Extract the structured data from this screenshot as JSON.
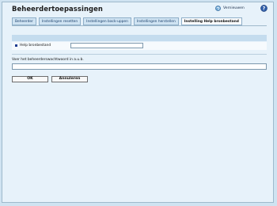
{
  "header": {
    "title": "Beheerdertoepassingen",
    "refresh_label": "Vernieuwen",
    "refresh_icon": "refresh-icon",
    "help_icon": "help-icon"
  },
  "tabs": [
    {
      "label": "Beheerder"
    },
    {
      "label": "Instellingen resetten"
    },
    {
      "label": "Instellingen back-uppen"
    },
    {
      "label": "Instellingen herstellen"
    },
    {
      "label": "Instelling Help bronbestand",
      "active": true
    }
  ],
  "section": {
    "title": "Instelling Help bronbestand",
    "field_label": "Help bronbestand",
    "field_value": ""
  },
  "password": {
    "label": "Voer het beheerderswachtwoord in a.u.b.",
    "value": ""
  },
  "buttons": {
    "ok": "OK",
    "cancel": "Annuleren"
  },
  "colors": {
    "background": "#cfe3f1",
    "panel": "#e7f2fa",
    "section_bar": "#c4dcee",
    "tab": "#cfe3f2",
    "tab_active": "#fbfdfe"
  }
}
